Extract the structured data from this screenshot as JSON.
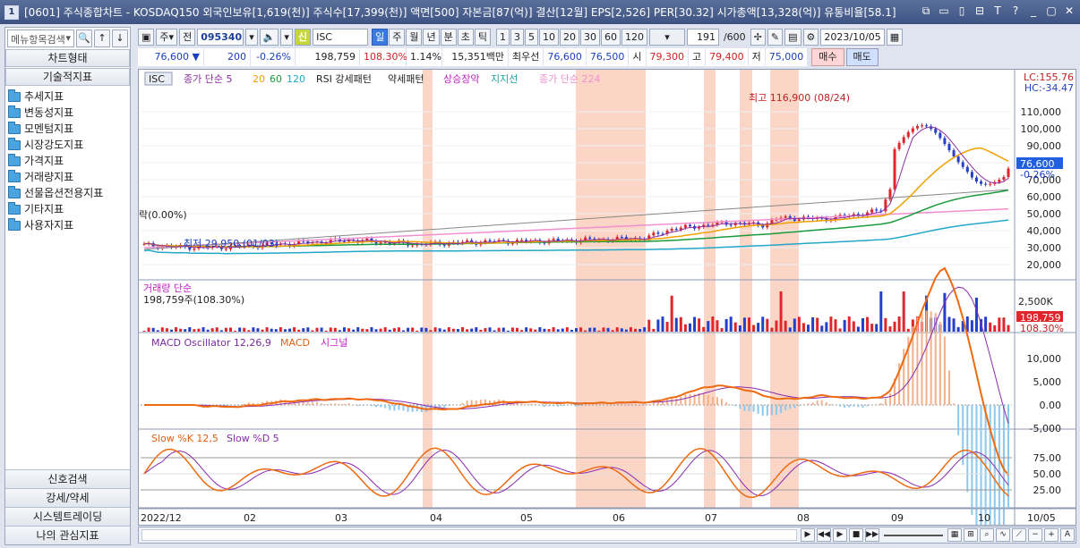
{
  "window": {
    "number": "1",
    "title": "[0601] 주식종합차트 - KOSDAQ150 외국인보유[1,619(천)] 주식수[17,399(천)] 액면[500] 자본금[87(억)] 결산[12월] EPS[2,526] PER[30.32] 시가총액[13,328(억)] 유통비율[58.1]",
    "controls": [
      "⧉",
      "▭",
      "▯",
      "⊟",
      "T",
      "?",
      "_",
      "▢",
      "✕"
    ]
  },
  "sidebar": {
    "search_placeholder": "메뉴항목검색",
    "chart_type": "차트형태",
    "tech": "기술적지표",
    "items": [
      "추세지표",
      "변동성지표",
      "모멘텀지표",
      "시장강도지표",
      "가격지표",
      "거래량지표",
      "선물옵션전용지표",
      "기타지표",
      "사용자지표"
    ],
    "bottom": [
      "신호검색",
      "강세/약세",
      "시스템트레이딩",
      "나의 관심지표"
    ]
  },
  "toolbar": {
    "period": "주",
    "prev": "전",
    "code": "095340",
    "new": "신",
    "name": "ISC",
    "tabs": [
      "일",
      "주",
      "월",
      "년",
      "분",
      "초",
      "틱"
    ],
    "nums": [
      "1",
      "3",
      "5",
      "10",
      "20",
      "30",
      "60",
      "120"
    ],
    "count": "191",
    "total": "/600",
    "date": "2023/10/05"
  },
  "quote": {
    "price": "76,600 ▼",
    "change": "200",
    "rate": "-0.26%",
    "volume": "198,759",
    "vol_rate": "108.30%",
    "turnover": "1.14%",
    "amount": "15,351백만",
    "best_label": "최우선",
    "best1": "76,600",
    "best2": "76,500",
    "open_l": "시",
    "open": "79,300",
    "high_l": "고",
    "high": "79,400",
    "low_l": "저",
    "low": "75,000",
    "buy": "매수",
    "sell": "매도"
  },
  "chart": {
    "legend": {
      "tag": "ISC",
      "ma5": "종가 단순 5",
      "ma20": "20",
      "ma60": "60",
      "ma120": "120",
      "rsi": "RSI 강세패턴",
      "weak": "약세패턴",
      "rise": "상승장악",
      "support": "지지선",
      "ma224": "종가 단순 224"
    },
    "lc": "LC:155.76",
    "hc": "HC:-34.47",
    "high_note": "최고 116,900 (08/24)",
    "low_note": "최저 29,950 (01/03)",
    "left_note": "락(0.00%)",
    "price_ticks": [
      "110,000",
      "100,000",
      "90,000",
      "80,000",
      "70,000",
      "60,000",
      "50,000",
      "40,000",
      "30,000",
      "20,000"
    ],
    "cur_price": "76,600",
    "cur_rate": "-0.26%",
    "vol_title": "거래량 단순",
    "vol_val": "198,759주(108.30%)",
    "vol_tick": "2,500K",
    "vol_cur": "198,759",
    "vol_rate": "108.30%",
    "macd_title": "MACD Oscillator 12,26,9",
    "macd_l": "MACD",
    "macd_sig": "시그널",
    "macd_ticks": [
      "10,000",
      "5,000",
      "0.00",
      "-5,000"
    ],
    "slow_k": "Slow %K 12,5",
    "slow_d": "Slow %D 5",
    "slow_ticks": [
      "75.00",
      "50.00",
      "25.00"
    ],
    "months": [
      "2022/12",
      "02",
      "03",
      "04",
      "05",
      "06",
      "07",
      "08",
      "09",
      "10",
      "10/05"
    ]
  },
  "colors": {
    "up": "#e0262a",
    "down": "#2440c8",
    "band": "#fbd6c6",
    "ma5": "#8e2ea0",
    "ma20": "#f0a000",
    "ma60": "#1a9a3a",
    "ma120": "#22a8c8",
    "ma224": "#f290d0"
  }
}
